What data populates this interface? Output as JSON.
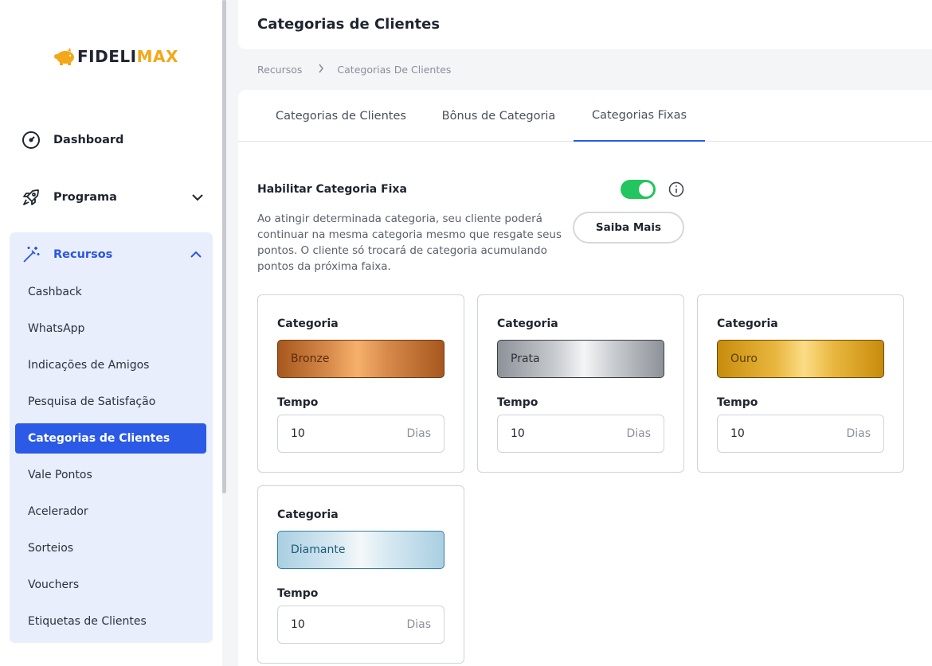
{
  "brand": {
    "logo_part1": "FIDELI",
    "logo_part2": "MAX"
  },
  "sidebar": {
    "dashboard": "Dashboard",
    "programa": "Programa",
    "recursos": "Recursos",
    "sub_items": [
      "Cashback",
      "WhatsApp",
      "Indicações de Amigos",
      "Pesquisa de Satisfação",
      "Categorias de Clientes",
      "Vale Pontos",
      "Acelerador",
      "Sorteios",
      "Vouchers",
      "Etiquetas de Clientes"
    ],
    "active_index": 4
  },
  "header": {
    "title": "Categorias de Clientes"
  },
  "breadcrumb": {
    "root": "Recursos",
    "current": "Categorias De Clientes"
  },
  "tabs": {
    "items": [
      "Categorias de Clientes",
      "Bônus de Categoria",
      "Categorias Fixas"
    ],
    "active_index": 2
  },
  "fixed": {
    "enable_label": "Habilitar Categoria Fixa",
    "enabled": true,
    "description": "Ao atingir determinada categoria, seu cliente poderá continuar na mesma categoria mesmo que resgate seus pontos. O cliente só trocará de categoria acumulando pontos da próxima faixa.",
    "learn_more": "Saiba Mais"
  },
  "categories": {
    "category_label": "Categoria",
    "time_label": "Tempo",
    "unit": "Dias",
    "items": [
      {
        "name": "Bronze",
        "days": "10"
      },
      {
        "name": "Prata",
        "days": "10"
      },
      {
        "name": "Ouro",
        "days": "10"
      },
      {
        "name": "Diamante",
        "days": "10"
      }
    ]
  },
  "colors": {
    "accent": "#2b5ae6",
    "toggle_on": "#22c55e",
    "brand_orange": "#f2a818"
  }
}
